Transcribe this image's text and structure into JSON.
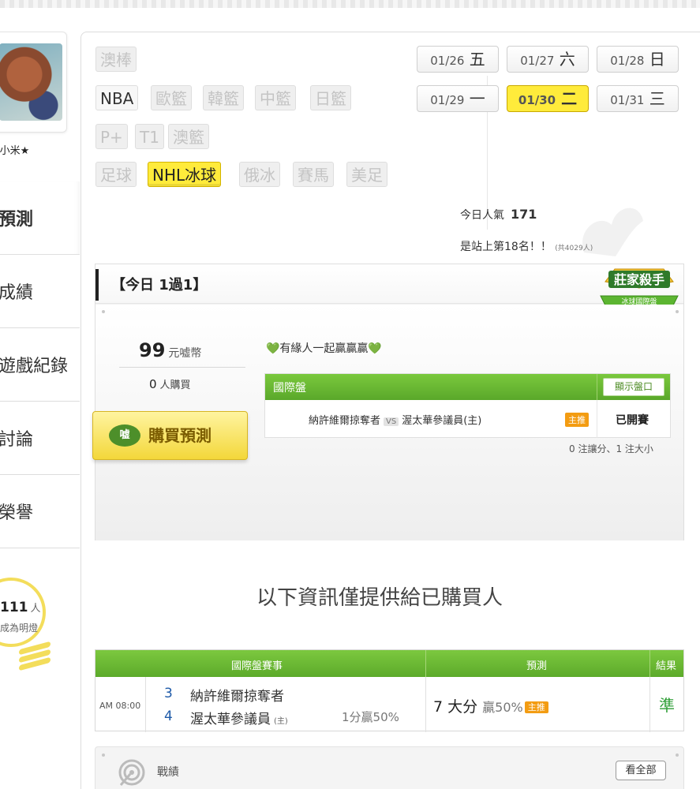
{
  "profile": {
    "username": "★小米★"
  },
  "sidebar": {
    "items": [
      {
        "label": "預測",
        "active": true
      },
      {
        "label": "成績"
      },
      {
        "label": "遊戲紀錄"
      },
      {
        "label": "討論"
      },
      {
        "label": "榮譽"
      }
    ],
    "bulb": {
      "count": "111",
      "unit": "人",
      "text": "成為明燈"
    }
  },
  "leagues": {
    "row1": [
      "澳棒"
    ],
    "row2": [
      "NBA",
      "歐籃",
      "韓籃",
      "中籃",
      "日籃"
    ],
    "row3": [
      "P+",
      "T1",
      "澳籃"
    ],
    "row4": [
      "足球",
      "NHL冰球",
      "俄冰",
      "賽馬",
      "美足"
    ],
    "active": "NHL冰球"
  },
  "dates": [
    {
      "date": "01/26",
      "day": "五"
    },
    {
      "date": "01/27",
      "day": "六"
    },
    {
      "date": "01/28",
      "day": "日"
    },
    {
      "date": "01/29",
      "day": "一"
    },
    {
      "date": "01/30",
      "day": "二",
      "active": true
    },
    {
      "date": "01/31",
      "day": "三"
    }
  ],
  "popularity": {
    "label": "今日人氣",
    "value": "171",
    "rank_text": "是站上第18名！！",
    "total": "(共4029人)"
  },
  "prediction": {
    "title": "【今日 1過1】",
    "badge": {
      "line1": "莊家殺手",
      "line2": "冰球國際盤"
    },
    "price": "99",
    "price_unit": "元嘘幣",
    "buyers": "0",
    "buyers_unit": "人購買",
    "buy_button": "購買預測",
    "buy_icon_text": "嘘",
    "memo": "💚有緣人一起贏贏贏💚",
    "handicap_title": "國際盤",
    "show_button": "顯示盤口",
    "match": {
      "away": "納許維爾掠奪者",
      "vs": "VS",
      "home": "渥太華參議員(主)",
      "tag": "主推",
      "status": "已開賽"
    },
    "note": "0 注讓分、1 注大小"
  },
  "lock_message": "以下資訊僅提供給已購買人",
  "result_table": {
    "headers": [
      "國際盤賽事",
      "預測",
      "結果"
    ],
    "row": {
      "time": "AM 08:00",
      "team1_no": "3",
      "team1": "納許維爾掠奪者",
      "team2_no": "4",
      "team2": "渥太華參議員",
      "team2_tag": "(主)",
      "odds": "1分贏50%",
      "prediction": "7 大分",
      "pct": "贏50%",
      "tag": "主推",
      "result": "準"
    }
  },
  "record": {
    "title": "戰績",
    "view_all": "看全部"
  },
  "colors": {
    "accent_yellow": "#ffeb3b",
    "header_green": "#5aa82a",
    "result_green": "#2e9e36",
    "tag_orange": "#f39c12"
  }
}
